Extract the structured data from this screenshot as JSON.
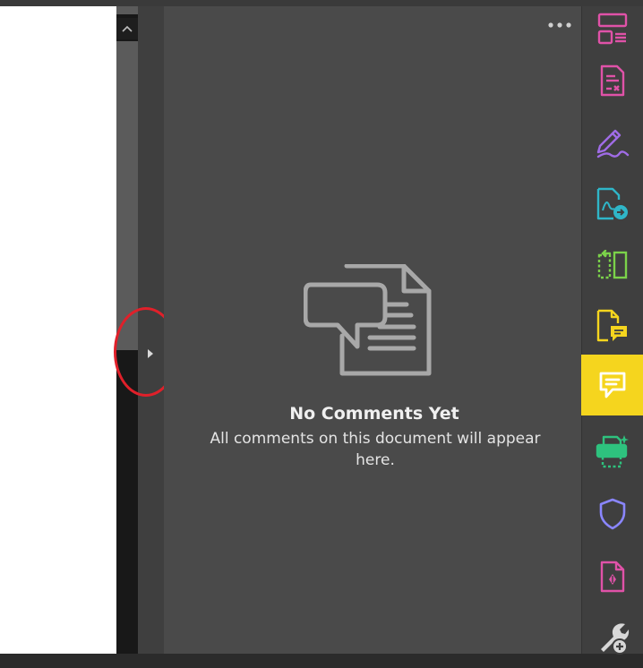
{
  "comments_panel": {
    "title": "No Comments Yet",
    "description": "All comments on this document will appear here."
  },
  "colors": {
    "active_tool_bg": "#f5d51e",
    "highlight_ring": "#e0202a",
    "panel_bg": "#4a4a4a",
    "rail_bg": "#3f3f3f"
  },
  "tool_rail": {
    "items": [
      {
        "icon": "organize-pages-icon",
        "color": "#e052a8"
      },
      {
        "icon": "fill-sign-doc-icon",
        "color": "#e052a8"
      },
      {
        "icon": "sign-pen-icon",
        "color": "#a06ce6"
      },
      {
        "icon": "export-pdf-icon",
        "color": "#2fb6c8"
      },
      {
        "icon": "compare-files-icon",
        "color": "#7bd24a"
      },
      {
        "icon": "comment-doc-icon",
        "color": "#f5d51e"
      },
      {
        "icon": "comment-icon",
        "color": "#ffffff",
        "active": true
      },
      {
        "icon": "print-production-icon",
        "color": "#2ec27e"
      },
      {
        "icon": "protect-shield-icon",
        "color": "#8a86ff"
      },
      {
        "icon": "prepare-form-icon",
        "color": "#e052a8"
      },
      {
        "icon": "more-tools-wrench-icon",
        "color": "#d8d8d8"
      }
    ]
  }
}
